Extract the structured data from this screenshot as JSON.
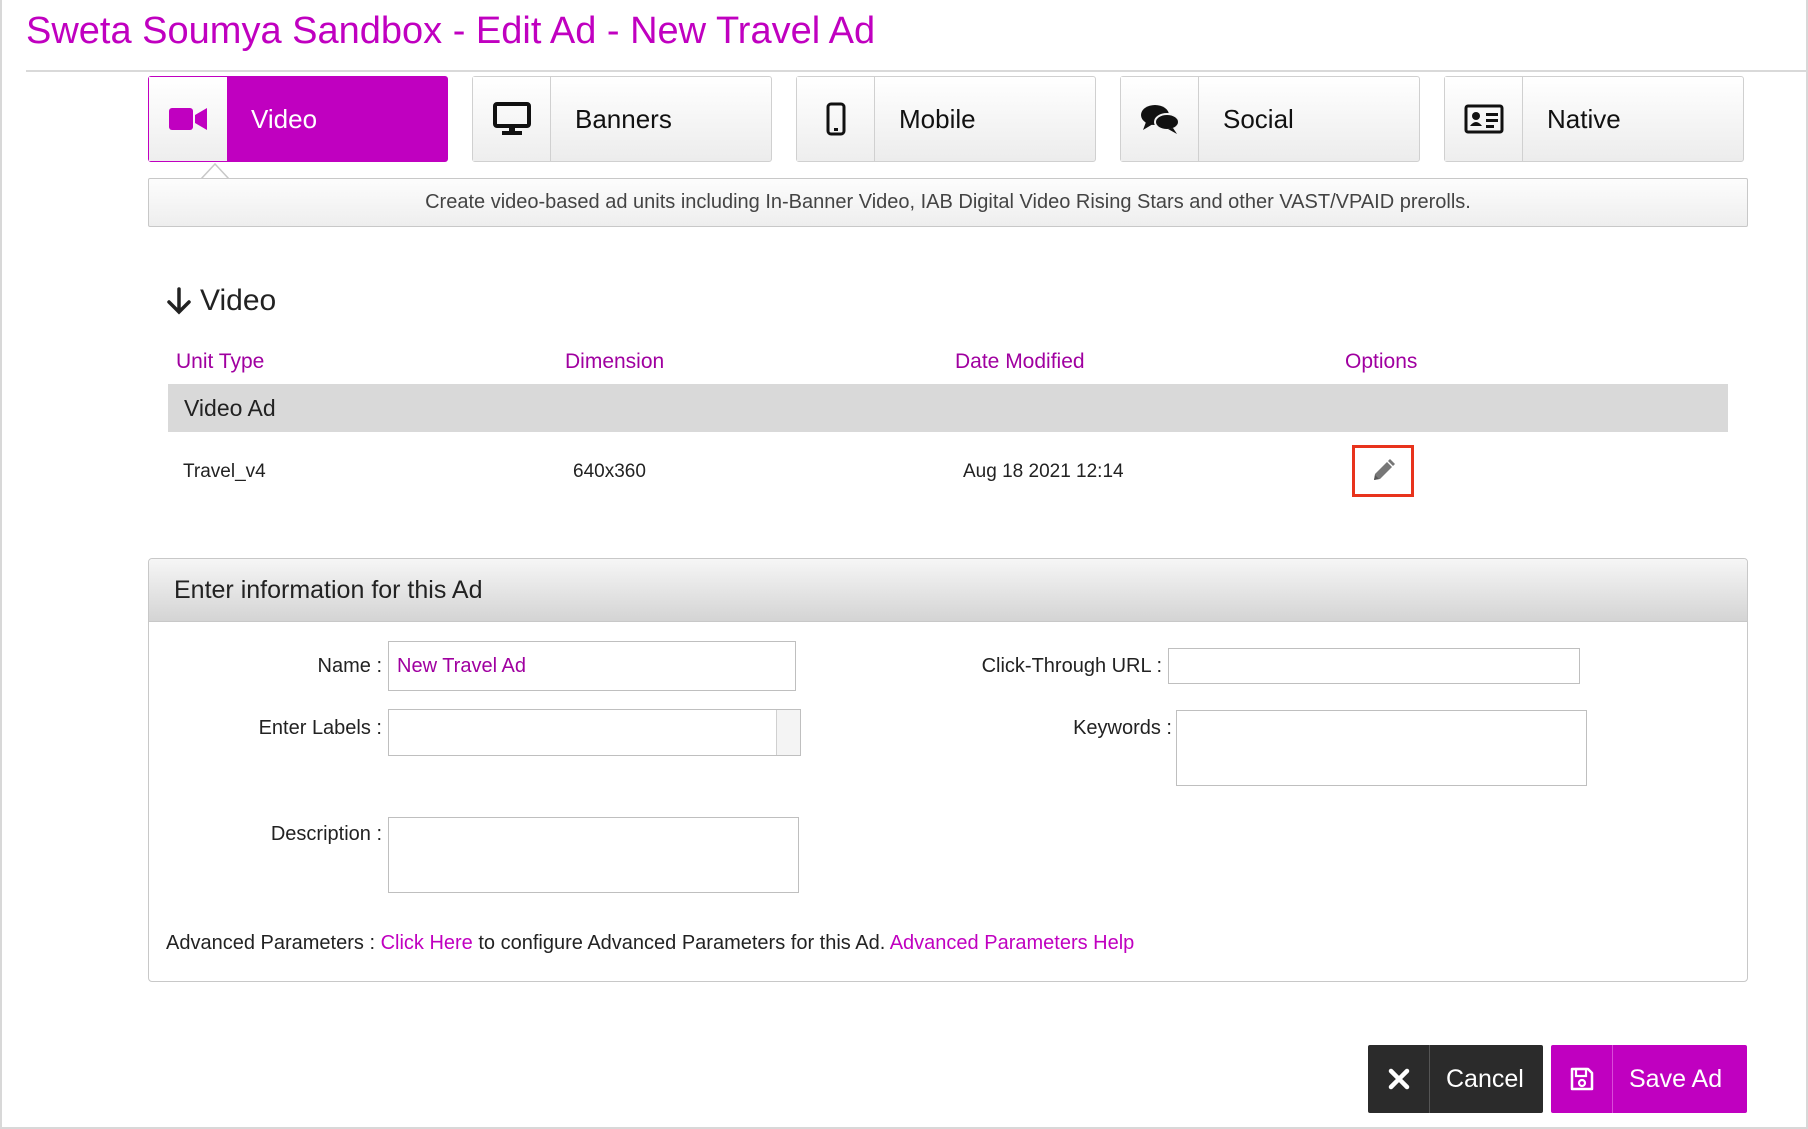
{
  "page": {
    "title": "Sweta Soumya Sandbox - Edit Ad - New Travel Ad"
  },
  "colors": {
    "accent": "#c000c0",
    "dark": "#2b2b2b",
    "highlight": "#e8331c"
  },
  "tabs": [
    {
      "label": "Video",
      "icon": "video-camera-icon",
      "active": true
    },
    {
      "label": "Banners",
      "icon": "monitor-icon",
      "active": false
    },
    {
      "label": "Mobile",
      "icon": "mobile-phone-icon",
      "active": false
    },
    {
      "label": "Social",
      "icon": "chat-bubbles-icon",
      "active": false
    },
    {
      "label": "Native",
      "icon": "id-card-icon",
      "active": false
    }
  ],
  "tab_description": "Create video-based ad units including In-Banner Video, IAB Digital Video Rising Stars and other VAST/VPAID prerolls.",
  "units": {
    "section_title": "Video",
    "columns": [
      "Unit Type",
      "Dimension",
      "Date Modified",
      "Options"
    ],
    "group": "Video Ad",
    "rows": [
      {
        "unit_type": "Travel_v4",
        "dimension": "640x360",
        "date_modified": "Aug 18 2021 12:14",
        "option_icon": "pencil-icon"
      }
    ]
  },
  "info_panel": {
    "title": "Enter information for this Ad",
    "name_label": "Name :",
    "name_value": "New Travel Ad",
    "labels_label": "Enter Labels :",
    "description_label": "Description :",
    "click_url_label": "Click-Through URL :",
    "keywords_label": "Keywords :",
    "advanced": {
      "prefix": "Advanced Parameters : ",
      "link": "Click Here",
      "middle": " to configure Advanced Parameters for this Ad. ",
      "help_link": "Advanced Parameters Help"
    }
  },
  "actions": {
    "cancel_label": "Cancel",
    "save_label": "Save Ad"
  }
}
